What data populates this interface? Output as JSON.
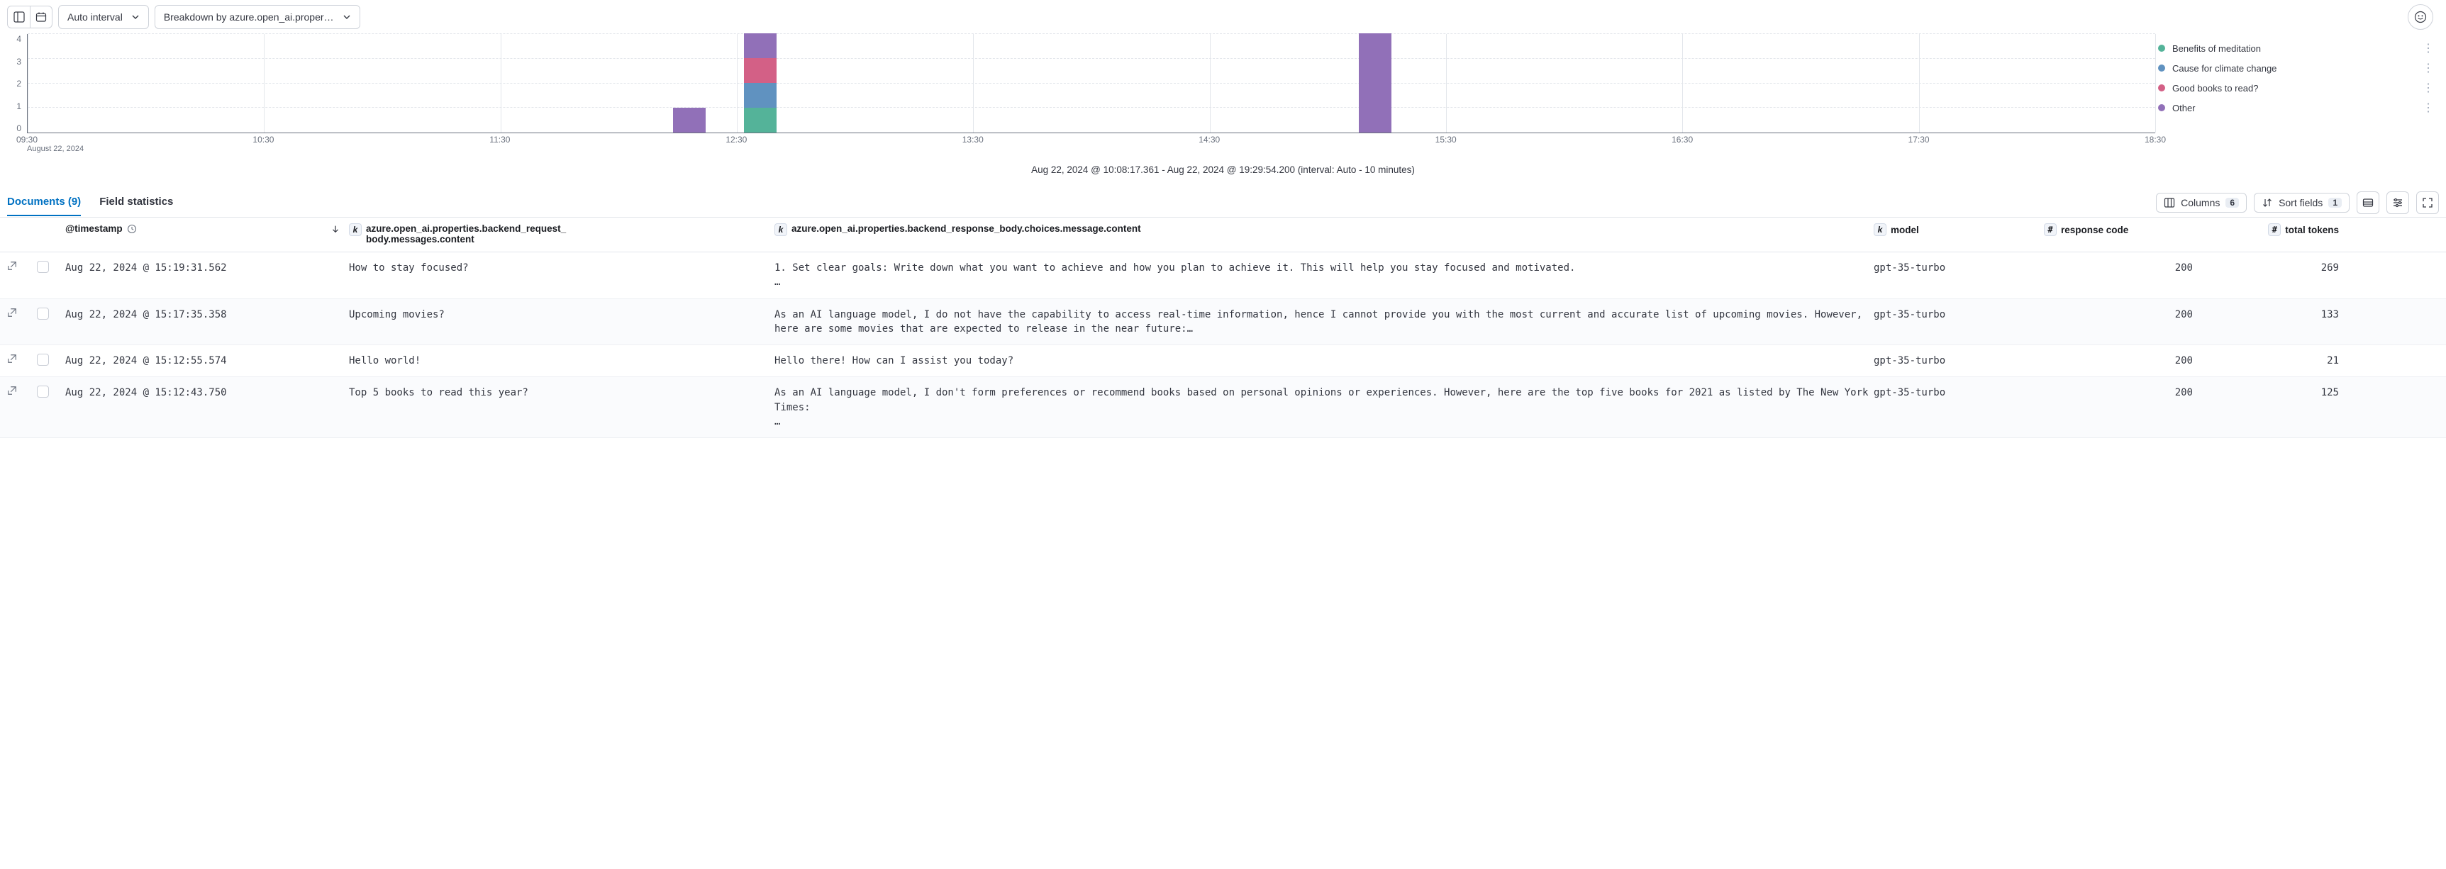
{
  "toolbar": {
    "interval_label": "Auto interval",
    "breakdown_label": "Breakdown by azure.open_ai.propertie…"
  },
  "chart_data": {
    "type": "bar",
    "y_ticks": [
      4,
      3,
      2,
      1,
      0
    ],
    "x_ticks": [
      "09:30",
      "10:30",
      "11:30",
      "12:30",
      "13:30",
      "14:30",
      "15:30",
      "16:30",
      "17:30",
      "18:30"
    ],
    "x_date": "August 22, 2024",
    "colors": {
      "benefits": "#54b399",
      "climate": "#6092c0",
      "books": "#d36086",
      "other": "#9170b8"
    },
    "legend": [
      {
        "key": "benefits",
        "label": "Benefits of meditation"
      },
      {
        "key": "climate",
        "label": "Cause for climate change"
      },
      {
        "key": "books",
        "label": "Good books to read?"
      },
      {
        "key": "other",
        "label": "Other"
      }
    ],
    "bars": [
      {
        "slot": 2.8,
        "stack": [
          {
            "key": "other",
            "value": 1
          }
        ]
      },
      {
        "slot": 3.1,
        "stack": [
          {
            "key": "benefits",
            "value": 1
          },
          {
            "key": "climate",
            "value": 1
          },
          {
            "key": "books",
            "value": 1
          },
          {
            "key": "other",
            "value": 1
          }
        ]
      },
      {
        "slot": 5.7,
        "stack": [
          {
            "key": "other",
            "value": 4
          }
        ]
      }
    ],
    "caption": "Aug 22, 2024 @ 10:08:17.361 - Aug 22, 2024 @ 19:29:54.200 (interval: Auto - 10 minutes)"
  },
  "tabs": {
    "documents_label": "Documents (9)",
    "stats_label": "Field statistics",
    "columns_label": "Columns",
    "columns_count": "6",
    "sort_label": "Sort fields",
    "sort_count": "1"
  },
  "columns": {
    "timestamp": "@timestamp",
    "request": "azure.open_ai.properties.backend_request_body.messages.content",
    "response": "azure.open_ai.properties.backend_response_body.choices.message.content",
    "model": "model",
    "code": "response code",
    "tokens": "total tokens"
  },
  "rows": [
    {
      "ts": "Aug 22, 2024 @ 15:19:31.562",
      "req": "How to stay focused?",
      "res": "1. Set clear goals: Write down what you want to achieve and how you plan to achieve it. This will help you stay focused and motivated.\n…",
      "model": "gpt-35-turbo",
      "code": "200",
      "tokens": "269"
    },
    {
      "ts": "Aug 22, 2024 @ 15:17:35.358",
      "req": "Upcoming movies?",
      "res": "As an AI language model, I do not have the capability to access real-time information, hence I cannot provide you with the most current and accurate list of upcoming movies. However, here are some movies that are expected to release in the near future:…",
      "model": "gpt-35-turbo",
      "code": "200",
      "tokens": "133"
    },
    {
      "ts": "Aug 22, 2024 @ 15:12:55.574",
      "req": "Hello world!",
      "res": "Hello there! How can I assist you today?",
      "model": "gpt-35-turbo",
      "code": "200",
      "tokens": "21"
    },
    {
      "ts": "Aug 22, 2024 @ 15:12:43.750",
      "req": "Top 5 books to read this year?",
      "res": "As an AI language model, I don't form preferences or recommend books based on personal opinions or experiences. However, here are the top five books for 2021 as listed by The New York Times:\n…",
      "model": "gpt-35-turbo",
      "code": "200",
      "tokens": "125"
    }
  ]
}
